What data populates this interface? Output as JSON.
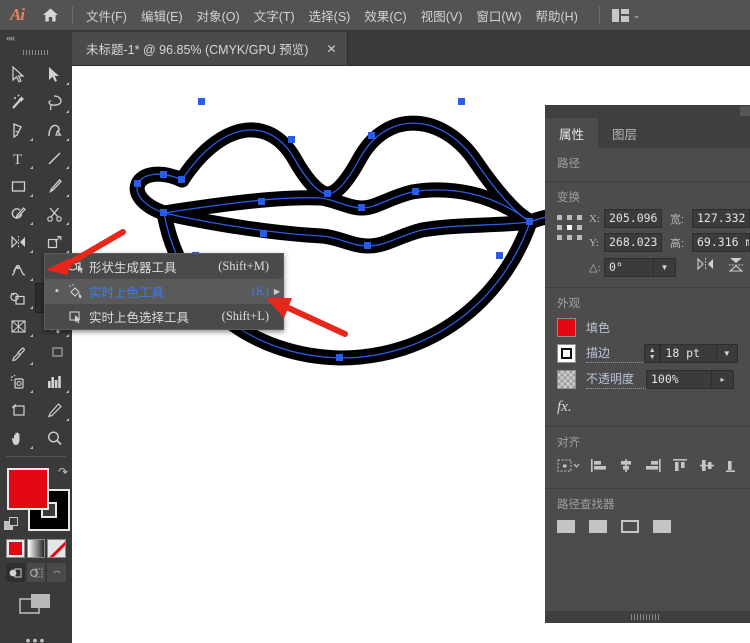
{
  "app": {
    "name": "Adobe Illustrator",
    "logo_text": "Ai"
  },
  "menubar": {
    "home_icon": "home-icon",
    "items": [
      {
        "label": "文件(F)"
      },
      {
        "label": "编辑(E)"
      },
      {
        "label": "对象(O)"
      },
      {
        "label": "文字(T)"
      },
      {
        "label": "选择(S)"
      },
      {
        "label": "效果(C)"
      },
      {
        "label": "视图(V)"
      },
      {
        "label": "窗口(W)"
      },
      {
        "label": "帮助(H)"
      }
    ],
    "workspace_switcher": {
      "icon": "workspace-grid-icon",
      "chevron": "⌄"
    }
  },
  "tabbar": {
    "document": {
      "title": "未标题-1* @ 96.85% (CMYK/GPU 预览)",
      "close": "✕"
    },
    "collapse": "««"
  },
  "toolbar": {
    "tools": [
      {
        "name": "selection-tool"
      },
      {
        "name": "direct-selection-tool"
      },
      {
        "name": "magic-wand-tool"
      },
      {
        "name": "lasso-tool"
      },
      {
        "name": "pen-tool"
      },
      {
        "name": "curvature-tool"
      },
      {
        "name": "type-tool"
      },
      {
        "name": "line-segment-tool"
      },
      {
        "name": "rectangle-tool"
      },
      {
        "name": "paintbrush-tool"
      },
      {
        "name": "shaper-tool"
      },
      {
        "name": "scissors-tool"
      },
      {
        "name": "rotate-tool"
      },
      {
        "name": "scale-tool"
      },
      {
        "name": "width-tool"
      },
      {
        "name": "free-transform-tool"
      },
      {
        "name": "shape-builder-tool"
      },
      {
        "name": "live-paint-bucket-tool"
      },
      {
        "name": "perspective-grid-tool"
      },
      {
        "name": "mesh-tool"
      },
      {
        "name": "eyedropper-tool"
      },
      {
        "name": "blend-tool"
      },
      {
        "name": "symbol-sprayer-tool"
      },
      {
        "name": "column-graph-tool"
      },
      {
        "name": "artboard-tool"
      },
      {
        "name": "slice-tool"
      },
      {
        "name": "hand-tool"
      },
      {
        "name": "zoom-tool"
      }
    ],
    "selected_tool": "live-paint-bucket-tool",
    "fill_color": "#e30613",
    "stroke_color": "#000000",
    "color_modes": [
      {
        "name": "color-mode-button",
        "kind": "solid"
      },
      {
        "name": "gradient-mode-button",
        "kind": "gradient"
      },
      {
        "name": "none-mode-button",
        "kind": "none"
      }
    ],
    "draw_modes": [
      {
        "name": "draw-normal-button"
      },
      {
        "name": "draw-behind-button"
      },
      {
        "name": "draw-inside-button"
      }
    ],
    "screen_mode": "change-screen-mode-button",
    "more_tools": "•••"
  },
  "flyout": {
    "items": [
      {
        "label": "形状生成器工具",
        "shortcut": "(Shift+M)",
        "icon": "shape-builder-icon",
        "active": false,
        "bullet": "",
        "submenu": false
      },
      {
        "label": "实时上色工具",
        "shortcut": "(K)",
        "icon": "live-paint-bucket-icon",
        "active": true,
        "bullet": "▪",
        "submenu": true
      },
      {
        "label": "实时上色选择工具",
        "shortcut": "(Shift+L)",
        "icon": "live-paint-selection-icon",
        "active": false,
        "bullet": "",
        "submenu": false
      }
    ]
  },
  "annotations": {
    "arrow_color": "#e8261a",
    "arrows": [
      {
        "name": "annotation-arrow-toolbar",
        "points_to": "live-paint-bucket-tool"
      },
      {
        "name": "annotation-arrow-menu",
        "points_to": "live-paint-shortcut"
      }
    ]
  },
  "panel": {
    "tabs": [
      {
        "label": "属性",
        "active": true
      },
      {
        "label": "图层",
        "active": false
      }
    ],
    "sections": {
      "path": {
        "title": "路径"
      },
      "transform": {
        "title": "变换",
        "reference_point": "transform-reference-point",
        "x_label": "X:",
        "x_value": "205.096",
        "y_label": "Y:",
        "y_value": "268.023",
        "w_label": "宽:",
        "w_value": "127.332",
        "h_label": "高:",
        "h_value": "69.316 m",
        "angle_label": "△:",
        "angle_value": "0°",
        "flip_h": "flip-horizontal-icon",
        "flip_v": "flip-vertical-icon"
      },
      "appearance": {
        "title": "外观",
        "fill_label": "填色",
        "fill_color": "#e30613",
        "stroke_label": "描边",
        "stroke_value": "18 pt",
        "opacity_label": "不透明度",
        "opacity_value": "100%",
        "fx_label": "fx."
      },
      "align": {
        "title": "对齐"
      },
      "pathfinder": {
        "title": "路径查找器"
      }
    }
  },
  "artwork": {
    "name": "lips-vector-artwork",
    "path_color": "#2a5ce8",
    "anchor_color": "#2a5ce8",
    "stroke_color": "#000000"
  }
}
